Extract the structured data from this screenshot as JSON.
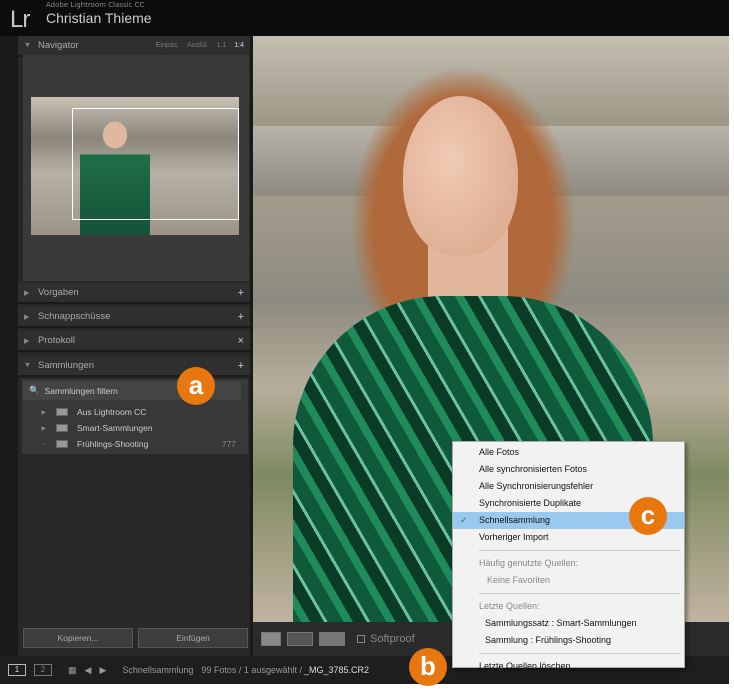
{
  "titlebar": {
    "logo": "Lr",
    "app": "Adobe Lightroom Classic CC",
    "user": "Christian Thieme"
  },
  "navigator": {
    "title": "Navigator",
    "zoom": [
      "Einpas.",
      "Ausfül.",
      "1:1",
      "1:4"
    ],
    "selected_zoom": "1:4"
  },
  "panels": [
    {
      "label": "Vorgaben",
      "action": "+"
    },
    {
      "label": "Schnappschüsse",
      "action": "+"
    },
    {
      "label": "Protokoll",
      "action": "×"
    },
    {
      "label": "Sammlungen",
      "action": "+"
    }
  ],
  "collections": {
    "filter_placeholder": "Sammlungen filtern",
    "items": [
      {
        "label": "Aus Lightroom CC",
        "count": ""
      },
      {
        "label": "Smart-Sammlungen",
        "count": ""
      },
      {
        "label": "Frühlings-Shooting",
        "count": "777"
      }
    ]
  },
  "buttons": {
    "copy": "Kopieren...",
    "paste": "Einfügen"
  },
  "toolbar": {
    "softproof": "Softproof"
  },
  "filmstrip": {
    "monitor1": "1",
    "monitor2": "2",
    "source": "Schnellsammlung",
    "info": "99 Fotos / 1 ausgewählt /",
    "filename": "_MG_3785.CR2"
  },
  "menu": {
    "items": [
      "Alle Fotos",
      "Alle synchronisierten Fotos",
      "Alle Synchronisierungsfehler",
      "Synchronisierte Duplikate",
      "Schnellsammlung",
      "Vorheriger Import"
    ],
    "selected": "Schnellsammlung",
    "frequent_header": "Häufig genutzte Quellen:",
    "no_favorites": "Keine Favoriten",
    "recent_header": "Letzte Quellen:",
    "recent": [
      "Sammlungssatz : Smart-Sammlungen",
      "Sammlung : Frühlings-Shooting"
    ],
    "clear": "Letzte Quellen löschen"
  },
  "badges": {
    "a": "a",
    "b": "b",
    "c": "c"
  },
  "colors": {
    "badge": "#e8770f",
    "menu_highlight": "#99c9ef"
  }
}
